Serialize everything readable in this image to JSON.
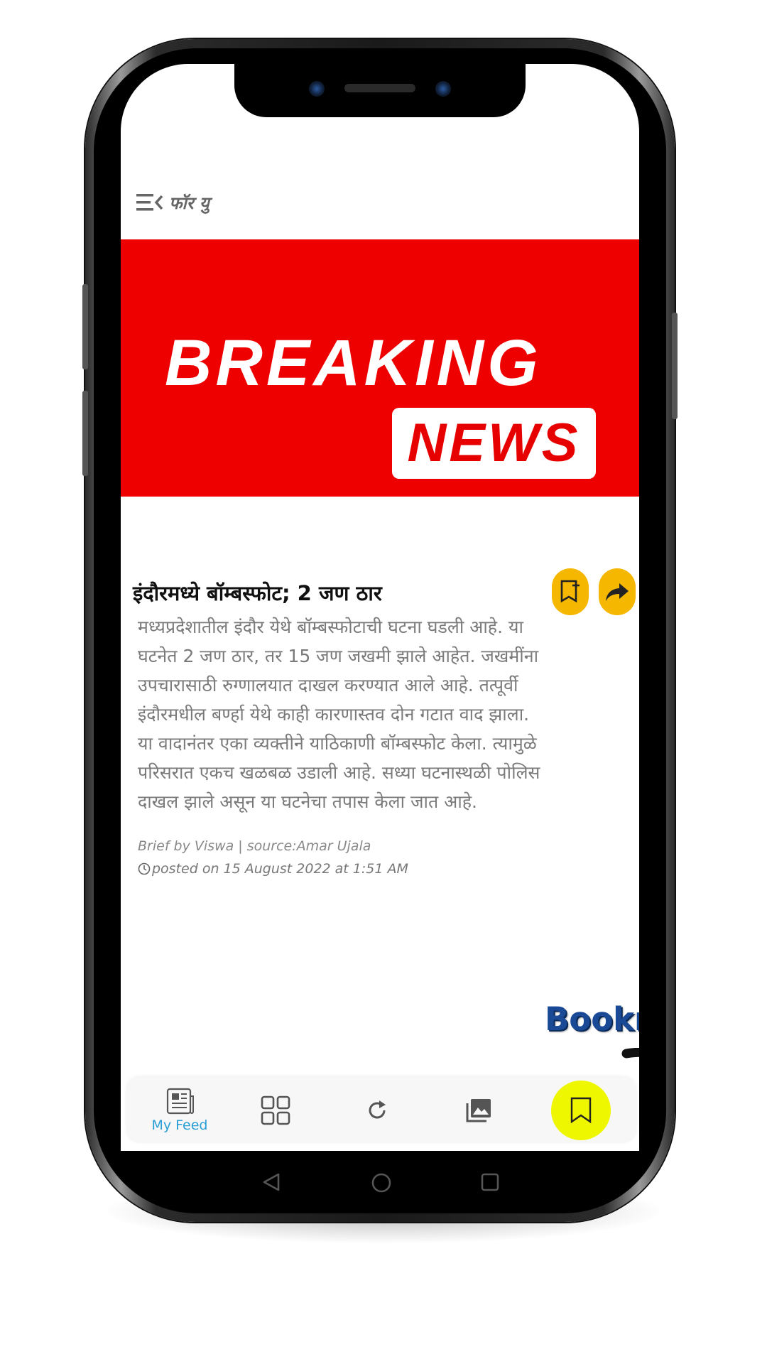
{
  "header": {
    "section_label": "फॉर यु"
  },
  "banner": {
    "line1": "BREAKING",
    "line2": "NEWS"
  },
  "article": {
    "headline": "इंदौरमध्ये बॉम्बस्फोट; 2 जण ठार",
    "body_lines": [
      "मध्यप्रदेशातील इंदौर येथे बॉम्बस्फोटाची घटना घडली आहे. या",
      "घटनेत 2 जण ठार, तर 15 जण जखमी झाले आहेत. जखमींना",
      "उपचारासाठी रुग्णालयात दाखल करण्यात आले आहे. तत्पूर्वी",
      "इंदौरमधील बर्ण्हा येथे काही कारणास्तव दोन गटात वाद झाला.",
      "या वादानंतर एका व्यक्तीने याठिकाणी बॉम्बस्फोट केला. त्यामुळे",
      "परिसरात एकच खळबळ उडाली आहे. सध्या घटनास्थळी पोलिस",
      "दाखल झाले असून या घटनेचा तपास केला जात आहे."
    ],
    "byline": "Brief by Viswa | source:Amar Ujala",
    "posted": "posted on 15 August 2022 at 1:51 AM",
    "actions": {
      "bookmark_icon": "bookmark-icon",
      "share_icon": "share-icon",
      "button_color": "#f5b700"
    }
  },
  "callout": {
    "text": "Bookmark"
  },
  "bottom_nav": {
    "items": [
      {
        "icon": "newspaper-icon",
        "label": "My Feed",
        "active": true
      },
      {
        "icon": "grid-icon",
        "label": ""
      },
      {
        "icon": "refresh-icon",
        "label": ""
      },
      {
        "icon": "gallery-icon",
        "label": ""
      },
      {
        "icon": "bookmark-icon",
        "label": "",
        "highlight_color": "#eef700"
      }
    ],
    "active_color": "#2a9fd6"
  },
  "system_nav": {
    "buttons": [
      "back-icon",
      "home-icon",
      "recents-icon"
    ]
  },
  "colors": {
    "banner_red": "#ee0000",
    "callout_blue": "#1a4a96"
  }
}
